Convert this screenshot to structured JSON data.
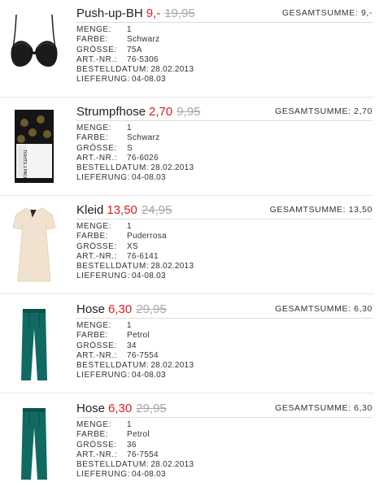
{
  "labels": {
    "menge": "MENGE:",
    "farbe": "FARBE:",
    "groesse": "GRÖSSE:",
    "art_nr": "ART.-NR.:",
    "bestelldatum": "BESTELLDATUM:",
    "lieferung": "LIEFERUNG:",
    "gesamtsumme": "GESAMTSUMME:"
  },
  "items": [
    {
      "name": "Push-up-BH",
      "price": "9,-",
      "old_price": "19,95",
      "total": "9,-",
      "menge": "1",
      "farbe": "Schwarz",
      "groesse": "75A",
      "art_nr": "76-5306",
      "bestelldatum": "28.02.2013",
      "lieferung": "04-08.03",
      "image": "black-bra-image"
    },
    {
      "name": "Strumpfhose",
      "price": "2,70",
      "old_price": "9,95",
      "total": "2,70",
      "menge": "1",
      "farbe": "Schwarz",
      "groesse": "S",
      "art_nr": "76-6026",
      "bestelldatum": "28.02.2013",
      "lieferung": "04-08.03",
      "image": "tights-package-image",
      "package_text": "TIGHTS 1 PACK"
    },
    {
      "name": "Kleid",
      "price": "13,50",
      "old_price": "24,95",
      "total": "13,50",
      "menge": "1",
      "farbe": "Puderrosa",
      "groesse": "XS",
      "art_nr": "76-6141",
      "bestelldatum": "28.02.2013",
      "lieferung": "04-08.03",
      "image": "dress-image"
    },
    {
      "name": "Hose",
      "price": "6,30",
      "old_price": "29,95",
      "total": "6,30",
      "menge": "1",
      "farbe": "Petrol",
      "groesse": "34",
      "art_nr": "76-7554",
      "bestelldatum": "28.02.2013",
      "lieferung": "04-08.03",
      "image": "trousers-image"
    },
    {
      "name": "Hose",
      "price": "6,30",
      "old_price": "29,95",
      "total": "6,30",
      "menge": "1",
      "farbe": "Petrol",
      "groesse": "36",
      "art_nr": "76-7554",
      "bestelldatum": "28.02.2013",
      "lieferung": "04-08.03",
      "image": "trousers-image"
    }
  ],
  "colors": {
    "sale_price": "#d52121",
    "old_price": "#a8a8a8",
    "dress": "#f1e2cf",
    "trousers": "#0f6a62"
  }
}
